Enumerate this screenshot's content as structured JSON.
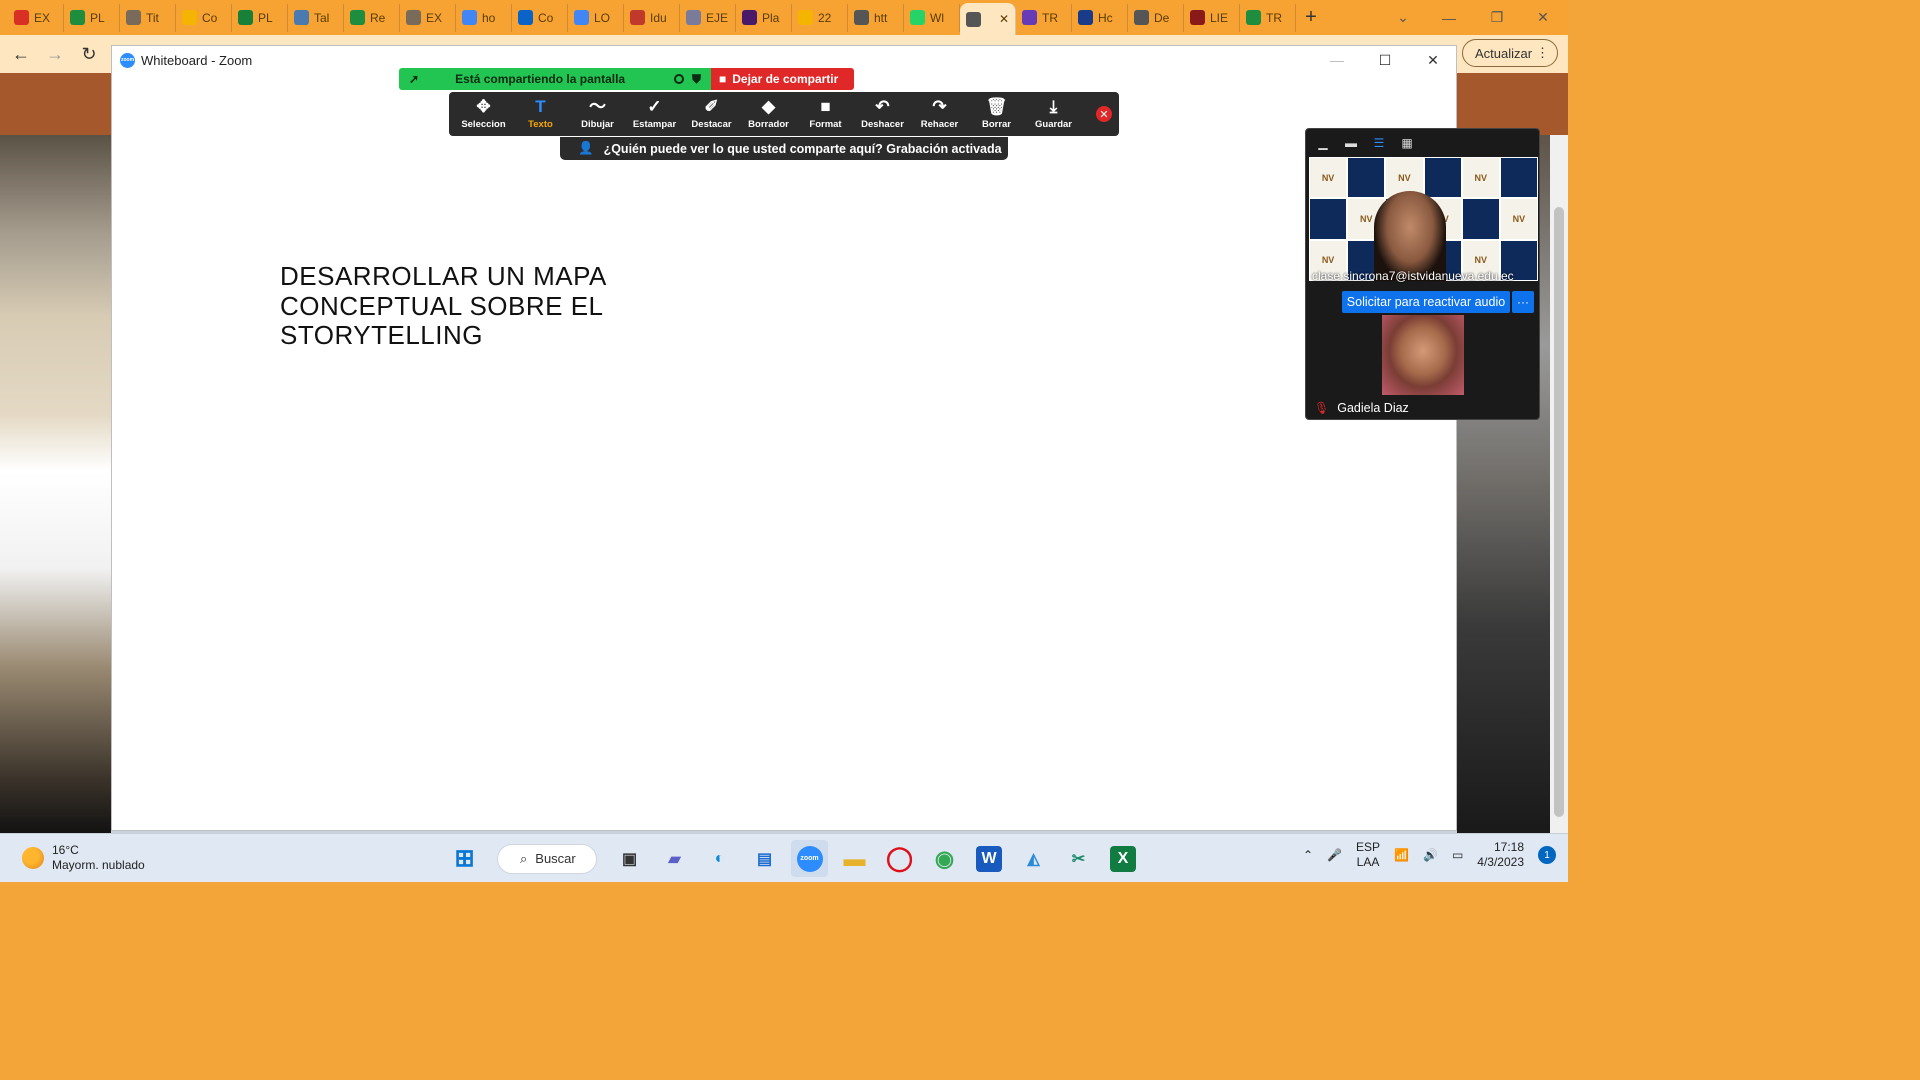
{
  "browser": {
    "tabs": [
      {
        "label": "EX",
        "icon": "gmail-icon",
        "color": "#d93025"
      },
      {
        "label": "PL",
        "icon": "drive-icon",
        "color": "#1e8e3e"
      },
      {
        "label": "Tit",
        "icon": "gear-site-icon",
        "color": "#7a6a5a"
      },
      {
        "label": "Co",
        "icon": "drive-icon",
        "color": "#f4b400"
      },
      {
        "label": "PL",
        "icon": "sheets-plus-icon",
        "color": "#188038"
      },
      {
        "label": "Tal",
        "icon": "site-icon",
        "color": "#4a7ab0"
      },
      {
        "label": "Re",
        "icon": "drive-icon",
        "color": "#1e8e3e"
      },
      {
        "label": "EX",
        "icon": "gear-site-icon",
        "color": "#7a6a5a"
      },
      {
        "label": "ho",
        "icon": "google-icon",
        "color": "#4285f4"
      },
      {
        "label": "Co",
        "icon": "outlook-icon",
        "color": "#0a64c8"
      },
      {
        "label": "LO",
        "icon": "google-icon",
        "color": "#4285f4"
      },
      {
        "label": "Idu",
        "icon": "site-icon",
        "color": "#c0392b"
      },
      {
        "label": "EJE",
        "icon": "site-icon",
        "color": "#7a7a9a"
      },
      {
        "label": "Pla",
        "icon": "quizlet-icon",
        "color": "#4a1a6a"
      },
      {
        "label": "22",
        "icon": "drive-icon",
        "color": "#f4b400"
      },
      {
        "label": "htt",
        "icon": "globe-icon",
        "color": "#555555"
      },
      {
        "label": "Wl",
        "icon": "whatsapp-icon",
        "color": "#25d366"
      },
      {
        "label": "",
        "icon": "globe-icon",
        "color": "#555555",
        "active": true
      },
      {
        "label": "TR",
        "icon": "forms-icon",
        "color": "#673ab7"
      },
      {
        "label": "Hc",
        "icon": "site-icon",
        "color": "#1a3a8a"
      },
      {
        "label": "De",
        "icon": "globe-icon",
        "color": "#555555"
      },
      {
        "label": "LIE",
        "icon": "site-icon",
        "color": "#8a1a1a"
      },
      {
        "label": "TR",
        "icon": "drive-icon",
        "color": "#1e8e3e"
      }
    ],
    "new_tab": "+",
    "update_label": "Actualizar"
  },
  "zoom": {
    "window_title": "Whiteboard - Zoom",
    "logo_text": "zoom",
    "share_status": "Está compartiendo la pantalla",
    "stop_share": "Dejar de compartir",
    "tools": [
      {
        "label": "Seleccion",
        "icon": "move-icon",
        "glyph": "✥"
      },
      {
        "label": "Texto",
        "icon": "text-icon",
        "glyph": "T",
        "active": true
      },
      {
        "label": "Dibujar",
        "icon": "draw-icon",
        "glyph": "〜"
      },
      {
        "label": "Estampar",
        "icon": "stamp-icon",
        "glyph": "✓"
      },
      {
        "label": "Destacar",
        "icon": "spotlight-icon",
        "glyph": "✐"
      },
      {
        "label": "Borrador",
        "icon": "eraser-icon",
        "glyph": "◆"
      },
      {
        "label": "Format",
        "icon": "format-icon",
        "glyph": "■"
      },
      {
        "label": "Deshacer",
        "icon": "undo-icon",
        "glyph": "↶"
      },
      {
        "label": "Rehacer",
        "icon": "redo-icon",
        "glyph": "↷"
      },
      {
        "label": "Borrar",
        "icon": "trash-icon",
        "glyph": "🗑"
      },
      {
        "label": "Guardar",
        "icon": "save-icon",
        "glyph": "⤓"
      }
    ],
    "who_can_see": "¿Quién puede ver lo que usted comparte aquí? Grabación activada",
    "whiteboard_text": "DESARROLLAR UN MAPA CONCEPTUAL SOBRE EL STORYTELLING",
    "video_panel": {
      "email": "clase.sincrona7@istvidanueva.edu.ec",
      "unmute": "Solicitar para reactivar audio",
      "more": "···",
      "participant_name": "Gadiela Diaz",
      "logo_tile_text": "NV"
    }
  },
  "taskbar": {
    "temperature": "16°C",
    "condition": "Mayorm. nublado",
    "search_label": "Buscar",
    "language": "ESP",
    "layout": "LAA",
    "time": "17:18",
    "date": "4/3/2023",
    "notifications": "1"
  }
}
